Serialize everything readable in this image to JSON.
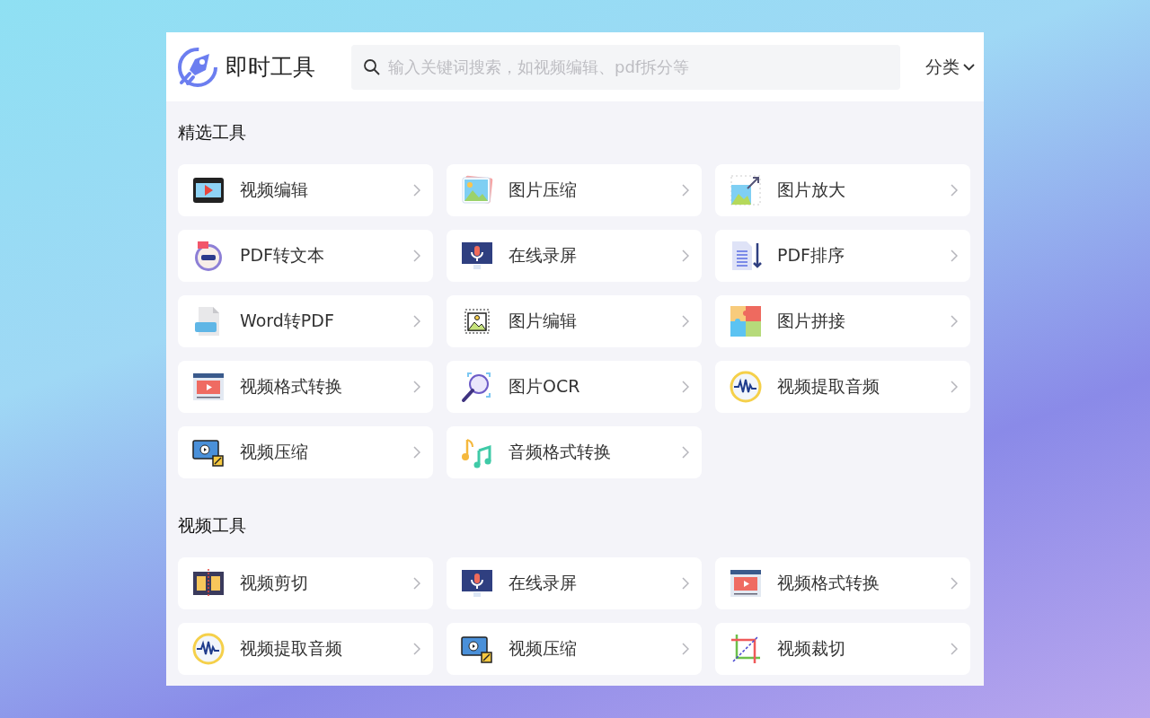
{
  "header": {
    "title": "即时工具",
    "search": {
      "placeholder": "输入关键词搜索，如视频编辑、pdf拆分等"
    },
    "category": "分类"
  },
  "sections": [
    {
      "title": "精选工具",
      "tools": [
        {
          "label": "视频编辑",
          "kind": "film"
        },
        {
          "label": "图片压缩",
          "kind": "image-stack"
        },
        {
          "label": "图片放大",
          "kind": "image-expand"
        },
        {
          "label": "PDF转文本",
          "kind": "ocr-doc"
        },
        {
          "label": "在线录屏",
          "kind": "mic-monitor"
        },
        {
          "label": "PDF排序",
          "kind": "doc-sort"
        },
        {
          "label": "Word转PDF",
          "kind": "doc-file"
        },
        {
          "label": "图片编辑",
          "kind": "image-edit"
        },
        {
          "label": "图片拼接",
          "kind": "puzzle"
        },
        {
          "label": "视频格式转换",
          "kind": "video-window"
        },
        {
          "label": "图片OCR",
          "kind": "magnifier"
        },
        {
          "label": "视频提取音频",
          "kind": "wave"
        },
        {
          "label": "视频压缩",
          "kind": "video-compress"
        },
        {
          "label": "音频格式转换",
          "kind": "music"
        }
      ]
    },
    {
      "title": "视频工具",
      "tools": [
        {
          "label": "视频剪切",
          "kind": "film-cut"
        },
        {
          "label": "在线录屏",
          "kind": "mic-monitor"
        },
        {
          "label": "视频格式转换",
          "kind": "video-window"
        },
        {
          "label": "视频提取音频",
          "kind": "wave"
        },
        {
          "label": "视频压缩",
          "kind": "video-compress"
        },
        {
          "label": "视频裁切",
          "kind": "crop"
        }
      ]
    }
  ]
}
